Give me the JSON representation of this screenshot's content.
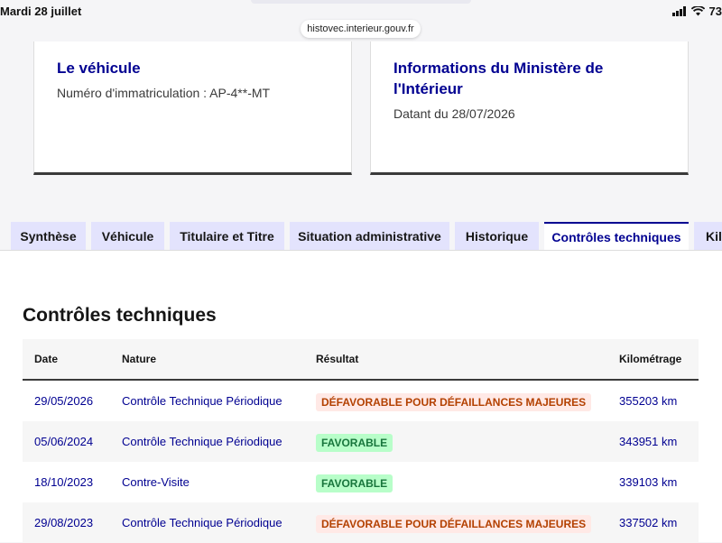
{
  "status_bar": {
    "time": "Mardi 28 juillet",
    "battery": "73"
  },
  "browser": {
    "url": "histovec.interieur.gouv.fr"
  },
  "cards": {
    "vehicle": {
      "title": "Le véhicule",
      "subtitle": "Numéro d'immatriculation : AP-4**-MT"
    },
    "ministry": {
      "title": "Informations du Ministère de l'Intérieur",
      "subtitle": "Datant du 28/07/2026"
    }
  },
  "tabs": [
    {
      "label": "Synthèse",
      "active": false
    },
    {
      "label": "Véhicule",
      "active": false
    },
    {
      "label": "Titulaire et Titre",
      "active": false
    },
    {
      "label": "Situation administrative",
      "active": false
    },
    {
      "label": "Historique",
      "active": false
    },
    {
      "label": "Contrôles techniques",
      "active": true
    },
    {
      "label": "Kilométrage",
      "active": false
    }
  ],
  "panel": {
    "title": "Contrôles techniques",
    "columns": [
      "Date",
      "Nature",
      "Résultat",
      "Kilométrage"
    ],
    "rows": [
      {
        "date": "29/05/2026",
        "nature": "Contrôle Technique Périodique",
        "result": "DÉFAVORABLE POUR DÉFAILLANCES MAJEURES",
        "result_type": "bad",
        "km": "355203 km"
      },
      {
        "date": "05/06/2024",
        "nature": "Contrôle Technique Périodique",
        "result": "FAVORABLE",
        "result_type": "good",
        "km": "343951 km"
      },
      {
        "date": "18/10/2023",
        "nature": "Contre-Visite",
        "result": "FAVORABLE",
        "result_type": "good",
        "km": "339103 km"
      },
      {
        "date": "29/08/2023",
        "nature": "Contrôle Technique Périodique",
        "result": "DÉFAVORABLE POUR DÉFAILLANCES MAJEURES",
        "result_type": "bad",
        "km": "337502 km"
      }
    ]
  },
  "colors": {
    "primary": "#000091",
    "tab_bg": "#e3e3fd",
    "bad_text": "#b34000",
    "bad_bg": "#ffe9e6",
    "good_text": "#18753c",
    "good_bg": "#b8fec9"
  },
  "icons": [
    "signal-icon",
    "wifi-icon",
    "battery-icon"
  ]
}
